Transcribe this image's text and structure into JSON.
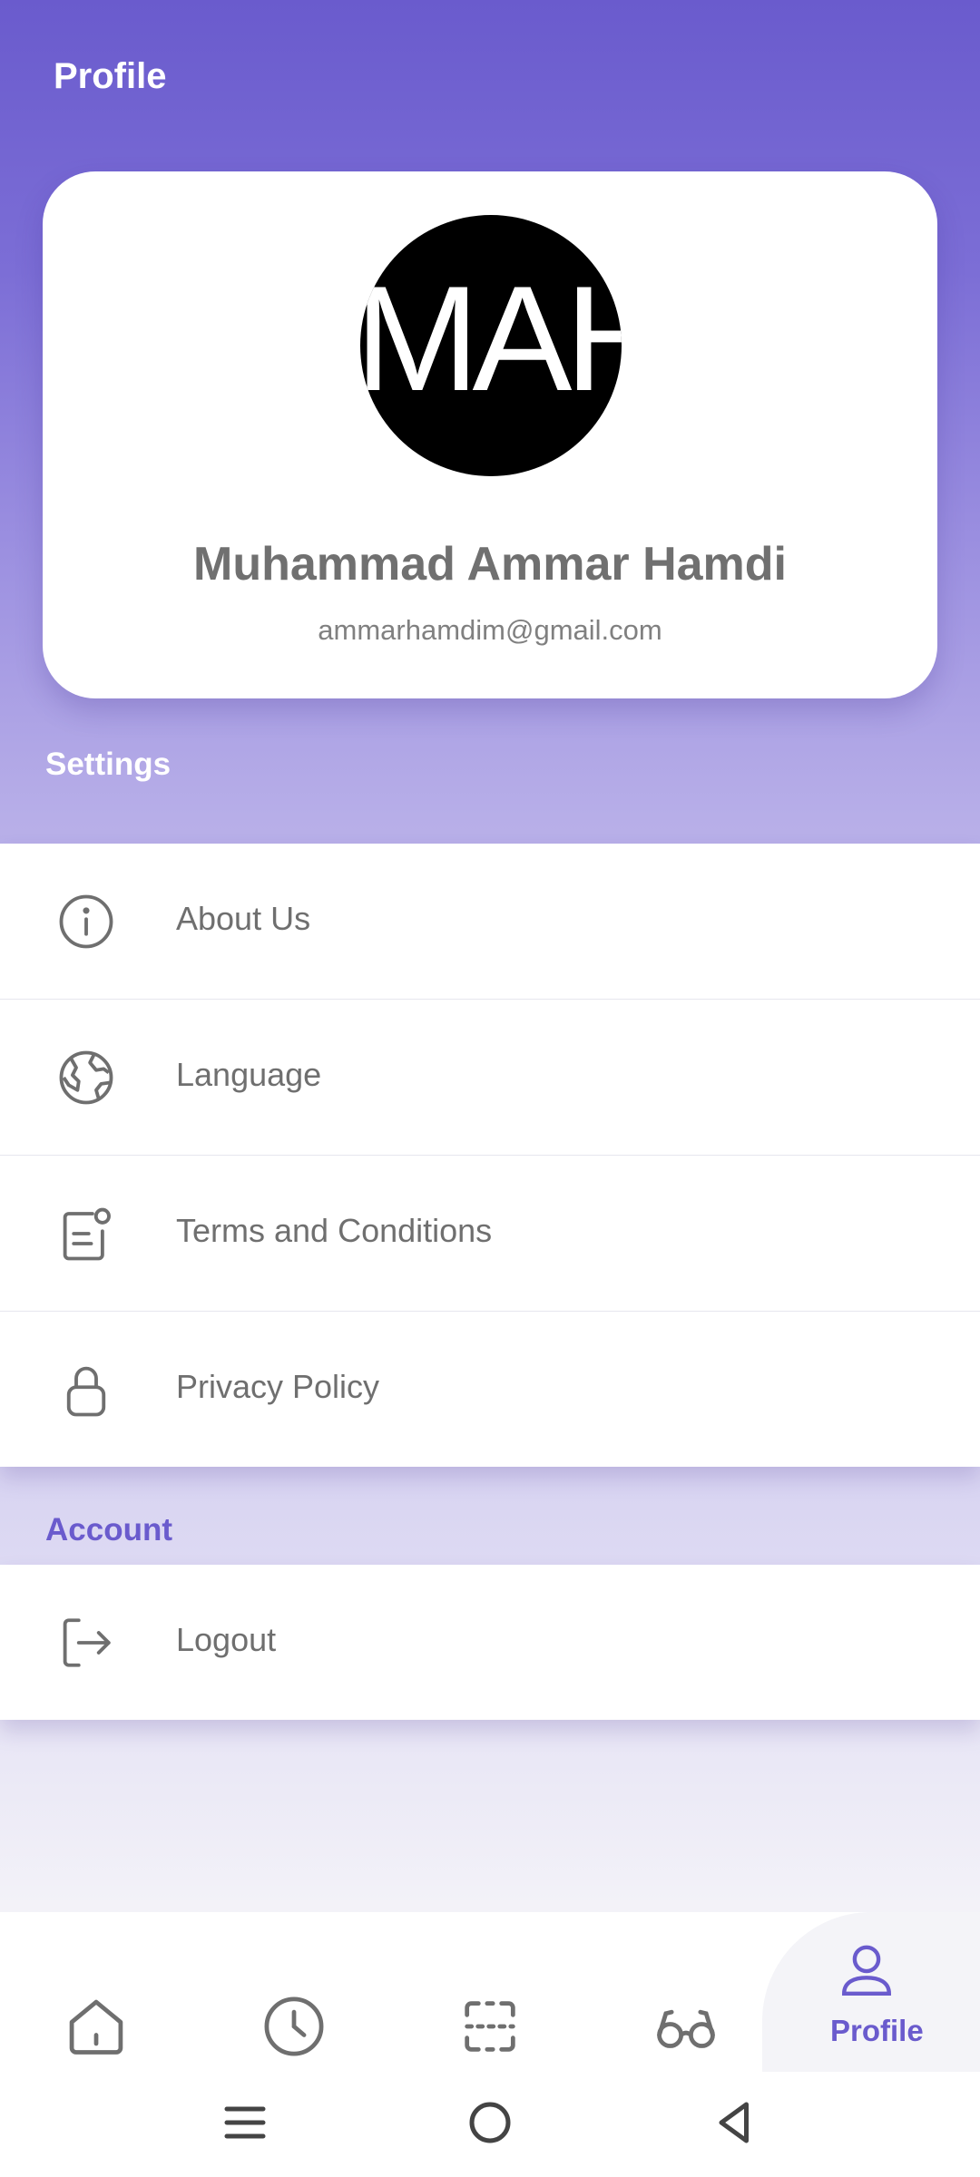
{
  "header": {
    "title": "Profile"
  },
  "profile": {
    "avatar_text": "MAH",
    "name": "Muhammad Ammar Hamdi",
    "email": "ammarhamdim@gmail.com"
  },
  "settings": {
    "label": "Settings",
    "items": [
      {
        "label": "About Us",
        "icon": "info-icon"
      },
      {
        "label": "Language",
        "icon": "globe-icon"
      },
      {
        "label": "Terms and Conditions",
        "icon": "document-icon"
      },
      {
        "label": "Privacy Policy",
        "icon": "lock-icon"
      }
    ]
  },
  "account": {
    "label": "Account",
    "items": [
      {
        "label": "Logout",
        "icon": "logout-icon"
      }
    ]
  },
  "bottom_nav": {
    "items": [
      {
        "icon": "home-icon"
      },
      {
        "icon": "clock-icon"
      },
      {
        "icon": "scan-icon"
      },
      {
        "icon": "glasses-icon"
      },
      {
        "icon": "user-icon",
        "label": "Profile",
        "active": true
      }
    ]
  },
  "colors": {
    "accent": "#6a5bcd",
    "text_gray": "#707070",
    "icon_gray": "#6f6f6f"
  }
}
